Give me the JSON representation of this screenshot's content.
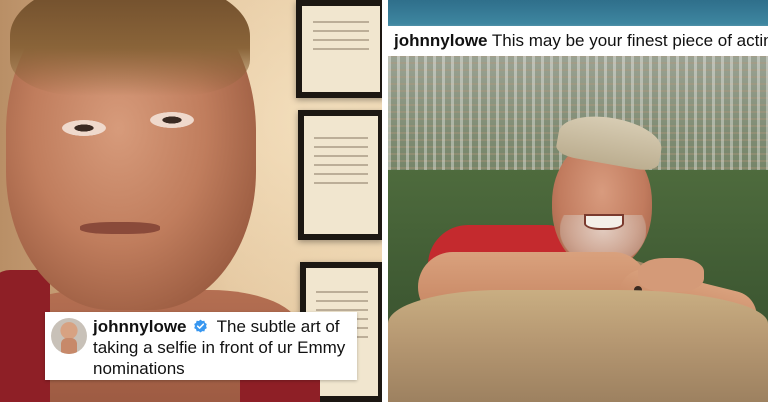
{
  "left_panel": {
    "caption": {
      "username": "johnnylowe",
      "verified_icon": "verified-badge-icon",
      "text": "The subtle art of taking a selfie in front of ur Emmy nominations"
    }
  },
  "right_panel": {
    "caption": {
      "username": "johnnylowe",
      "text": "This may be your finest piece of acting"
    }
  },
  "colors": {
    "verified_badge": "#3897f0",
    "caption_background": "#ffffff",
    "caption_text": "#111111"
  }
}
